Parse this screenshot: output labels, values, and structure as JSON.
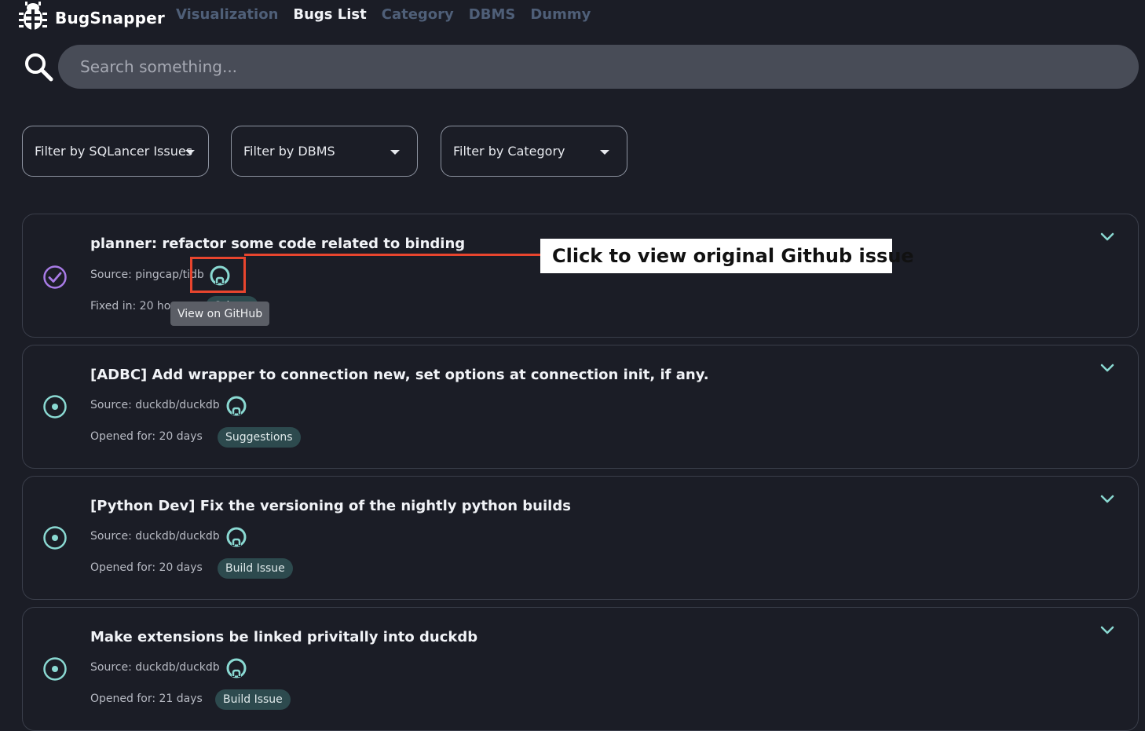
{
  "app": {
    "name": "BugSnapper"
  },
  "nav": {
    "links": [
      "Visualization",
      "Bugs List",
      "Category",
      "DBMS",
      "Dummy"
    ],
    "active": "Bugs List"
  },
  "search": {
    "placeholder": "Search something..."
  },
  "filters": [
    {
      "label": "Filter by SQLancer Issues"
    },
    {
      "label": "Filter by DBMS"
    },
    {
      "label": "Filter by Category"
    }
  ],
  "bugs": [
    {
      "title": "planner: refactor some code related to binding",
      "source": "Source: pingcap/tidb",
      "age": "Fixed in: 20 hours",
      "tag": "Others",
      "status": "fixed"
    },
    {
      "title": "[ADBC] Add wrapper to connection new, set options at connection init, if any.",
      "source": "Source: duckdb/duckdb",
      "age": "Opened for: 20 days",
      "tag": "Suggestions",
      "status": "open"
    },
    {
      "title": "[Python Dev] Fix the versioning of the nightly python builds",
      "source": "Source: duckdb/duckdb",
      "age": "Opened for: 20 days",
      "tag": "Build Issue",
      "status": "open"
    },
    {
      "title": "Make extensions be linked privitally into duckdb",
      "source": "Source: duckdb/duckdb",
      "age": "Opened for: 21 days",
      "tag": "Build Issue",
      "status": "open"
    }
  ],
  "tooltip": {
    "text": "View on GitHub"
  },
  "annotation": {
    "text": "Click to view original Github issue"
  },
  "colors": {
    "background": "#1b1d26",
    "accent_teal": "#8ad9d2",
    "fixed_purple": "#a87be6",
    "annotation_red": "#e8452e"
  }
}
